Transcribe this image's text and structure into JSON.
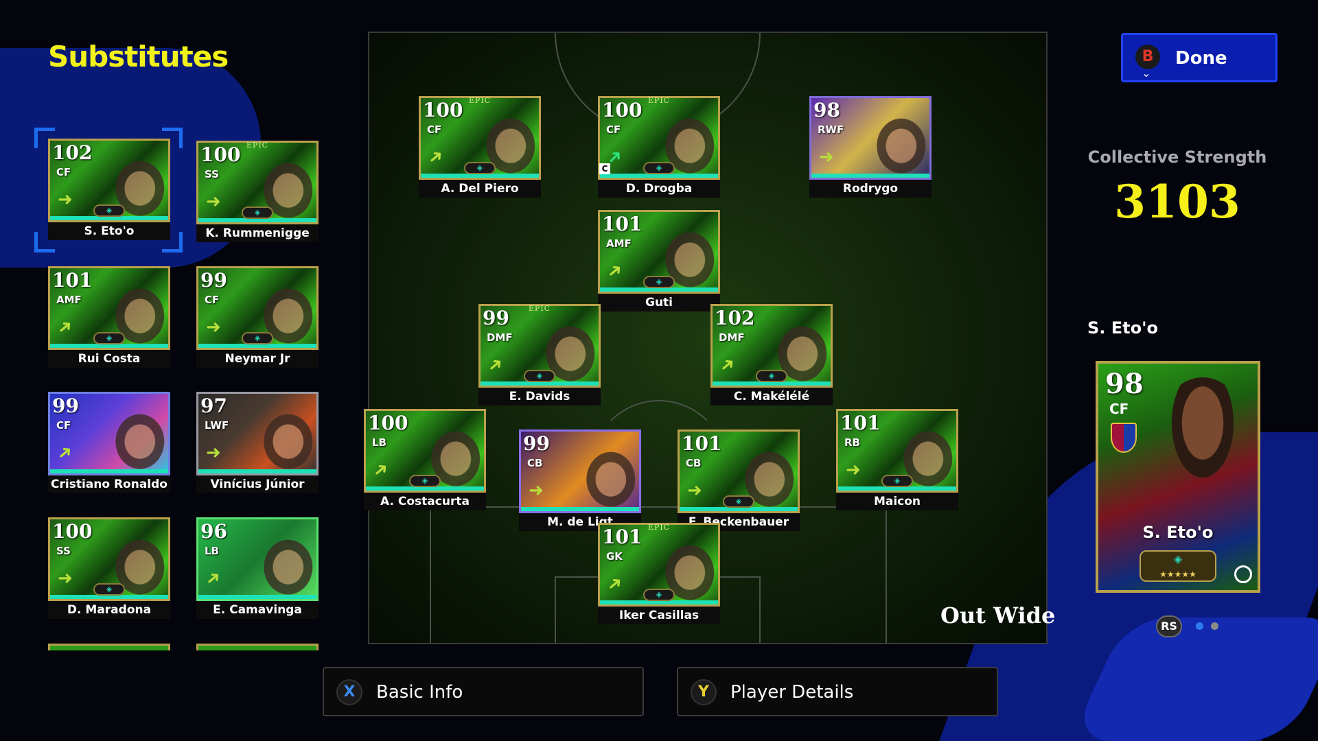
{
  "substitutes": {
    "title": "Substitutes",
    "players": [
      {
        "rating": "102",
        "pos": "CF",
        "name": "S. Eto'o",
        "style": "green",
        "selected": true,
        "arrow": "right"
      },
      {
        "rating": "100",
        "pos": "SS",
        "name": "K. Rummenigge",
        "style": "green",
        "epic": "EPIC",
        "arrow": "right"
      },
      {
        "rating": "101",
        "pos": "AMF",
        "name": "Rui Costa",
        "style": "green",
        "arrow": "upright"
      },
      {
        "rating": "99",
        "pos": "CF",
        "name": "Neymar Jr",
        "style": "green",
        "arrow": "right"
      },
      {
        "rating": "99",
        "pos": "CF",
        "name": "Cristiano Ronaldo",
        "style": "blue",
        "arrow": "upright"
      },
      {
        "rating": "97",
        "pos": "LWF",
        "name": "Vinícius Júnior",
        "style": "dark",
        "arrow": "right"
      },
      {
        "rating": "100",
        "pos": "SS",
        "name": "D. Maradona",
        "style": "green",
        "arrow": "right"
      },
      {
        "rating": "96",
        "pos": "LB",
        "name": "E. Camavinga",
        "style": "pow",
        "arrow": "upright"
      }
    ]
  },
  "pitch": {
    "formation_label": "Out Wide",
    "players": [
      {
        "rating": "100",
        "pos": "CF",
        "name": "A. Del Piero",
        "style": "green",
        "epic": "EPIC",
        "arrow": "upright"
      },
      {
        "rating": "100",
        "pos": "CF",
        "name": "D. Drogba",
        "style": "green",
        "epic": "EPIC",
        "arrow": "up",
        "captain": "C"
      },
      {
        "rating": "98",
        "pos": "RWF",
        "name": "Rodrygo",
        "style": "purple",
        "arrow": "right"
      },
      {
        "rating": "101",
        "pos": "AMF",
        "name": "Guti",
        "style": "green",
        "arrow": "upright"
      },
      {
        "rating": "99",
        "pos": "DMF",
        "name": "E. Davids",
        "style": "green",
        "epic": "EPIC",
        "arrow": "upright"
      },
      {
        "rating": "102",
        "pos": "DMF",
        "name": "C. Makélélé",
        "style": "green",
        "arrow": "upright"
      },
      {
        "rating": "100",
        "pos": "LB",
        "name": "A. Costacurta",
        "style": "green",
        "arrow": "upright"
      },
      {
        "rating": "99",
        "pos": "CB",
        "name": "M. de Ligt",
        "style": "halloween",
        "arrow": "right"
      },
      {
        "rating": "101",
        "pos": "CB",
        "name": "F. Beckenbauer",
        "style": "green",
        "arrow": "right"
      },
      {
        "rating": "101",
        "pos": "RB",
        "name": "Maicon",
        "style": "green",
        "arrow": "right"
      },
      {
        "rating": "101",
        "pos": "GK",
        "name": "Iker Casillas",
        "style": "green",
        "epic": "EPIC",
        "arrow": "upright"
      }
    ]
  },
  "done_button": {
    "key": "B",
    "label": "Done"
  },
  "collective_strength": {
    "label": "Collective Strength",
    "value": "3103"
  },
  "selected_player": {
    "name": "S. Eto'o",
    "card_rating": "98",
    "card_pos": "CF",
    "card_name": "S. Eto'o",
    "stars": "★★★★★"
  },
  "pager": {
    "key": "RS",
    "pages": 2,
    "current": 1
  },
  "bottom_buttons": [
    {
      "key": "X",
      "label": "Basic Info",
      "key_color": "#3a8cf0"
    },
    {
      "key": "Y",
      "label": "Player Details",
      "key_color": "#e8d030"
    }
  ],
  "colors": {
    "accent_yellow": "#f5ef1a",
    "done_blue": "#0a1fb0",
    "card_bar": "#1de2b8"
  }
}
